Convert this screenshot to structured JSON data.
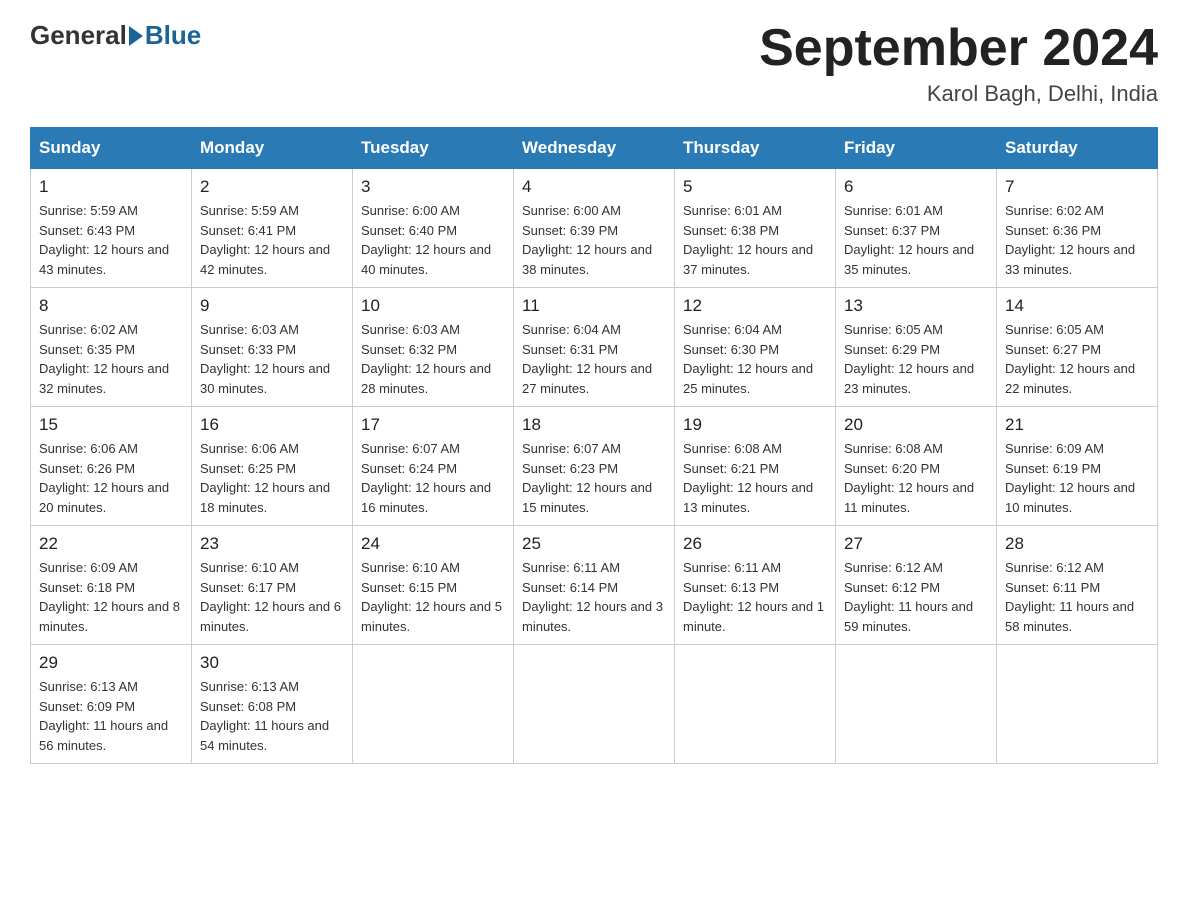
{
  "header": {
    "logo_general": "General",
    "logo_blue": "Blue",
    "month_title": "September 2024",
    "location": "Karol Bagh, Delhi, India"
  },
  "weekdays": [
    "Sunday",
    "Monday",
    "Tuesday",
    "Wednesday",
    "Thursday",
    "Friday",
    "Saturday"
  ],
  "weeks": [
    [
      {
        "day": "1",
        "sunrise": "Sunrise: 5:59 AM",
        "sunset": "Sunset: 6:43 PM",
        "daylight": "Daylight: 12 hours and 43 minutes."
      },
      {
        "day": "2",
        "sunrise": "Sunrise: 5:59 AM",
        "sunset": "Sunset: 6:41 PM",
        "daylight": "Daylight: 12 hours and 42 minutes."
      },
      {
        "day": "3",
        "sunrise": "Sunrise: 6:00 AM",
        "sunset": "Sunset: 6:40 PM",
        "daylight": "Daylight: 12 hours and 40 minutes."
      },
      {
        "day": "4",
        "sunrise": "Sunrise: 6:00 AM",
        "sunset": "Sunset: 6:39 PM",
        "daylight": "Daylight: 12 hours and 38 minutes."
      },
      {
        "day": "5",
        "sunrise": "Sunrise: 6:01 AM",
        "sunset": "Sunset: 6:38 PM",
        "daylight": "Daylight: 12 hours and 37 minutes."
      },
      {
        "day": "6",
        "sunrise": "Sunrise: 6:01 AM",
        "sunset": "Sunset: 6:37 PM",
        "daylight": "Daylight: 12 hours and 35 minutes."
      },
      {
        "day": "7",
        "sunrise": "Sunrise: 6:02 AM",
        "sunset": "Sunset: 6:36 PM",
        "daylight": "Daylight: 12 hours and 33 minutes."
      }
    ],
    [
      {
        "day": "8",
        "sunrise": "Sunrise: 6:02 AM",
        "sunset": "Sunset: 6:35 PM",
        "daylight": "Daylight: 12 hours and 32 minutes."
      },
      {
        "day": "9",
        "sunrise": "Sunrise: 6:03 AM",
        "sunset": "Sunset: 6:33 PM",
        "daylight": "Daylight: 12 hours and 30 minutes."
      },
      {
        "day": "10",
        "sunrise": "Sunrise: 6:03 AM",
        "sunset": "Sunset: 6:32 PM",
        "daylight": "Daylight: 12 hours and 28 minutes."
      },
      {
        "day": "11",
        "sunrise": "Sunrise: 6:04 AM",
        "sunset": "Sunset: 6:31 PM",
        "daylight": "Daylight: 12 hours and 27 minutes."
      },
      {
        "day": "12",
        "sunrise": "Sunrise: 6:04 AM",
        "sunset": "Sunset: 6:30 PM",
        "daylight": "Daylight: 12 hours and 25 minutes."
      },
      {
        "day": "13",
        "sunrise": "Sunrise: 6:05 AM",
        "sunset": "Sunset: 6:29 PM",
        "daylight": "Daylight: 12 hours and 23 minutes."
      },
      {
        "day": "14",
        "sunrise": "Sunrise: 6:05 AM",
        "sunset": "Sunset: 6:27 PM",
        "daylight": "Daylight: 12 hours and 22 minutes."
      }
    ],
    [
      {
        "day": "15",
        "sunrise": "Sunrise: 6:06 AM",
        "sunset": "Sunset: 6:26 PM",
        "daylight": "Daylight: 12 hours and 20 minutes."
      },
      {
        "day": "16",
        "sunrise": "Sunrise: 6:06 AM",
        "sunset": "Sunset: 6:25 PM",
        "daylight": "Daylight: 12 hours and 18 minutes."
      },
      {
        "day": "17",
        "sunrise": "Sunrise: 6:07 AM",
        "sunset": "Sunset: 6:24 PM",
        "daylight": "Daylight: 12 hours and 16 minutes."
      },
      {
        "day": "18",
        "sunrise": "Sunrise: 6:07 AM",
        "sunset": "Sunset: 6:23 PM",
        "daylight": "Daylight: 12 hours and 15 minutes."
      },
      {
        "day": "19",
        "sunrise": "Sunrise: 6:08 AM",
        "sunset": "Sunset: 6:21 PM",
        "daylight": "Daylight: 12 hours and 13 minutes."
      },
      {
        "day": "20",
        "sunrise": "Sunrise: 6:08 AM",
        "sunset": "Sunset: 6:20 PM",
        "daylight": "Daylight: 12 hours and 11 minutes."
      },
      {
        "day": "21",
        "sunrise": "Sunrise: 6:09 AM",
        "sunset": "Sunset: 6:19 PM",
        "daylight": "Daylight: 12 hours and 10 minutes."
      }
    ],
    [
      {
        "day": "22",
        "sunrise": "Sunrise: 6:09 AM",
        "sunset": "Sunset: 6:18 PM",
        "daylight": "Daylight: 12 hours and 8 minutes."
      },
      {
        "day": "23",
        "sunrise": "Sunrise: 6:10 AM",
        "sunset": "Sunset: 6:17 PM",
        "daylight": "Daylight: 12 hours and 6 minutes."
      },
      {
        "day": "24",
        "sunrise": "Sunrise: 6:10 AM",
        "sunset": "Sunset: 6:15 PM",
        "daylight": "Daylight: 12 hours and 5 minutes."
      },
      {
        "day": "25",
        "sunrise": "Sunrise: 6:11 AM",
        "sunset": "Sunset: 6:14 PM",
        "daylight": "Daylight: 12 hours and 3 minutes."
      },
      {
        "day": "26",
        "sunrise": "Sunrise: 6:11 AM",
        "sunset": "Sunset: 6:13 PM",
        "daylight": "Daylight: 12 hours and 1 minute."
      },
      {
        "day": "27",
        "sunrise": "Sunrise: 6:12 AM",
        "sunset": "Sunset: 6:12 PM",
        "daylight": "Daylight: 11 hours and 59 minutes."
      },
      {
        "day": "28",
        "sunrise": "Sunrise: 6:12 AM",
        "sunset": "Sunset: 6:11 PM",
        "daylight": "Daylight: 11 hours and 58 minutes."
      }
    ],
    [
      {
        "day": "29",
        "sunrise": "Sunrise: 6:13 AM",
        "sunset": "Sunset: 6:09 PM",
        "daylight": "Daylight: 11 hours and 56 minutes."
      },
      {
        "day": "30",
        "sunrise": "Sunrise: 6:13 AM",
        "sunset": "Sunset: 6:08 PM",
        "daylight": "Daylight: 11 hours and 54 minutes."
      },
      null,
      null,
      null,
      null,
      null
    ]
  ]
}
